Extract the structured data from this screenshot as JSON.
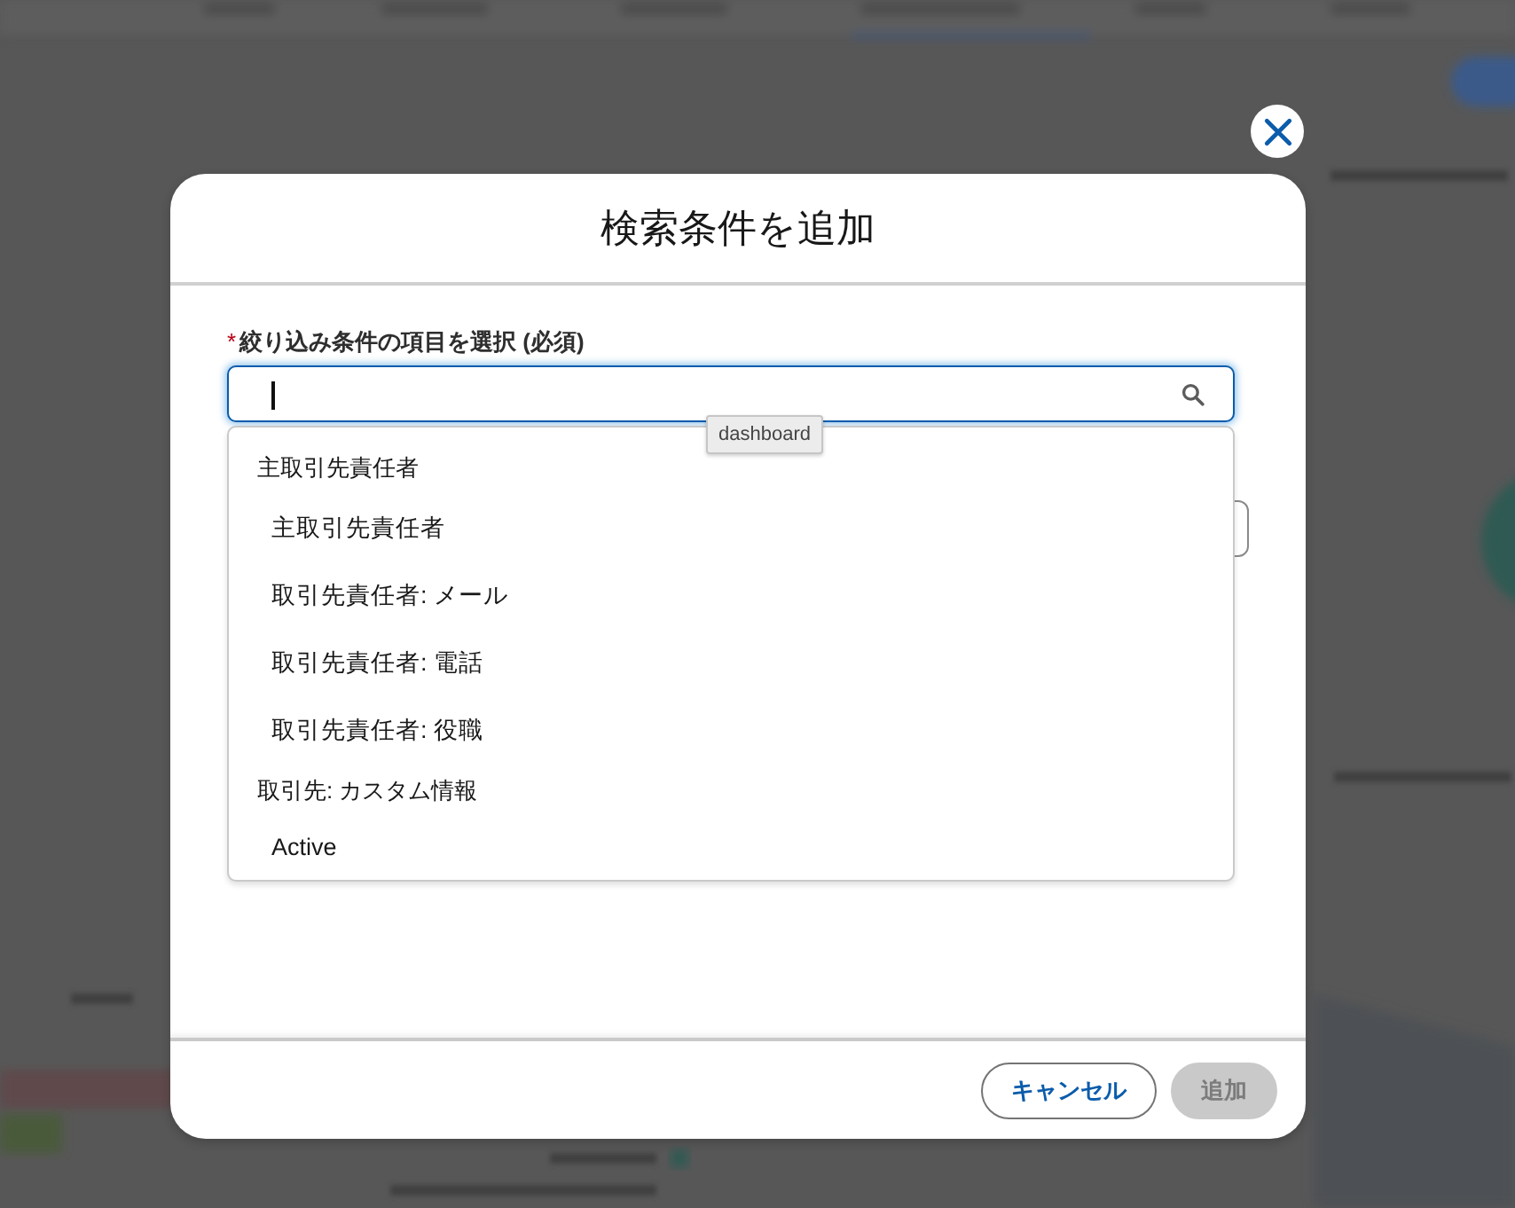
{
  "dialog": {
    "title": "検索条件を追加"
  },
  "field": {
    "required_mark": "*",
    "label": "絞り込み条件の項目を選択 (必須)",
    "focused": true
  },
  "tooltip": {
    "text": "dashboard"
  },
  "dropdown": {
    "groups": [
      {
        "label": "主取引先責任者",
        "options": [
          {
            "label": "主取引先責任者"
          },
          {
            "label": "取引先責任者: メール"
          },
          {
            "label": "取引先責任者: 電話"
          },
          {
            "label": "取引先責任者: 役職"
          }
        ]
      },
      {
        "label": "取引先: カスタム情報",
        "options": [
          {
            "label": "Active"
          }
        ]
      }
    ]
  },
  "buttons": [
    {
      "label": "キャンセル",
      "kind": "neutral",
      "disabled": false
    },
    {
      "label": "追加",
      "kind": "brand",
      "disabled": true
    }
  ]
}
